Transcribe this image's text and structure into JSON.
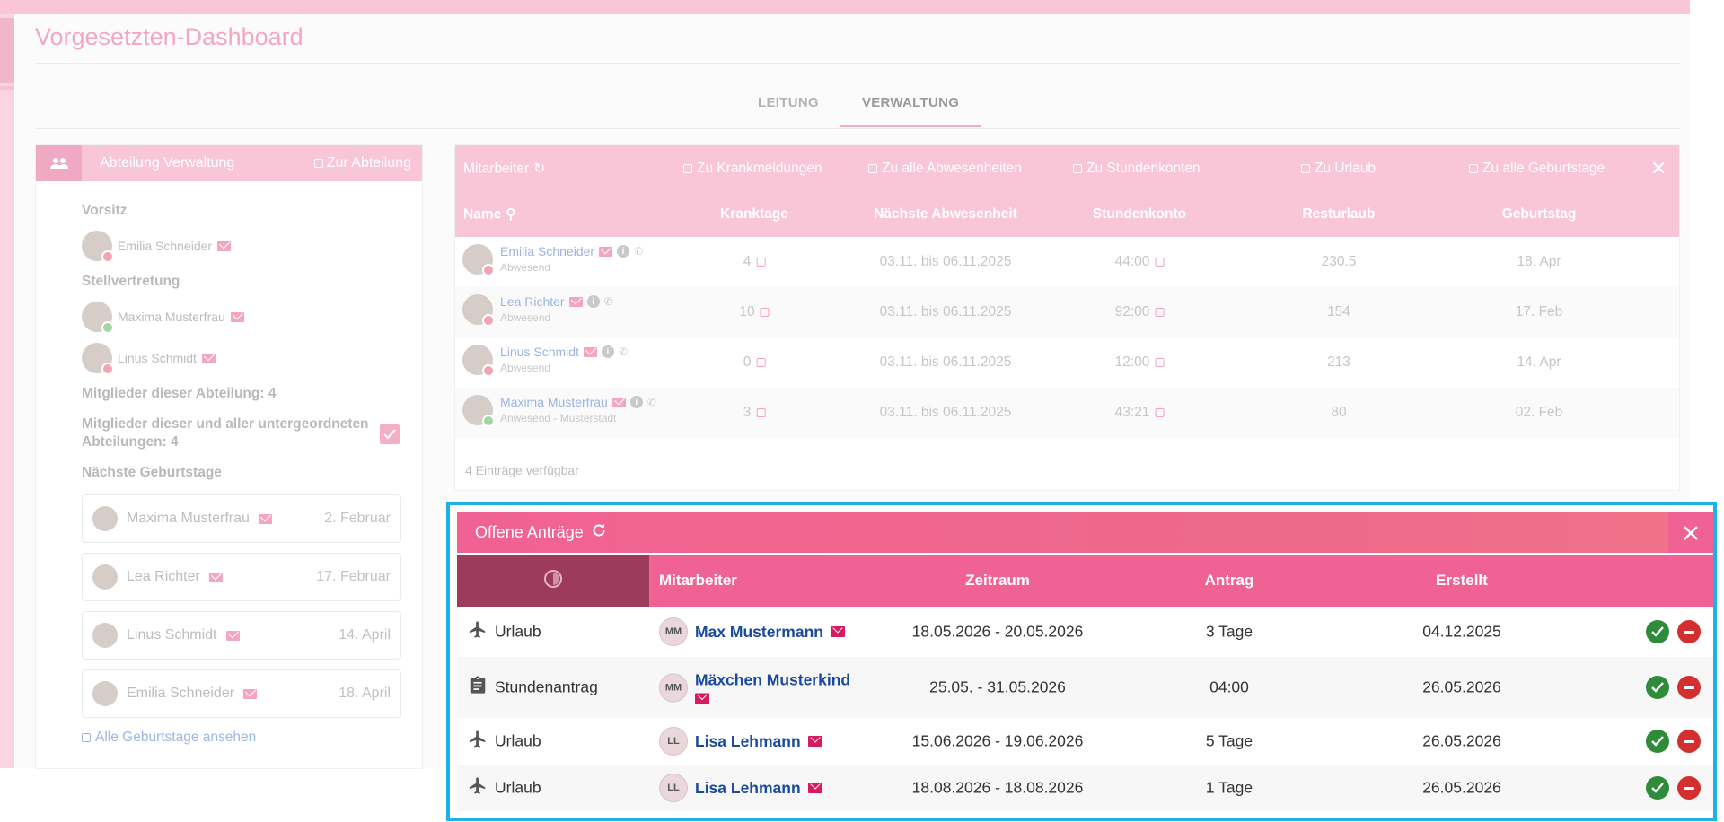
{
  "page": {
    "title": "Vorgesetzten-Dashboard"
  },
  "tabs": [
    {
      "label": "LEITUNG"
    },
    {
      "label": "VERWALTUNG"
    }
  ],
  "department": {
    "title": "Abteilung Verwaltung",
    "link": "Zur Abteilung",
    "chair_label": "Vorsitz",
    "chair": "Emilia Schneider",
    "deputy_label": "Stellvertretung",
    "deputies": [
      "Maxima Musterfrau",
      "Linus Schmidt"
    ],
    "members_count": "Mitglieder dieser Abteilung: 4",
    "members_all_line1": "Mitglieder dieser und aller untergeordneten",
    "members_all_line2": "Abteilungen: 4",
    "birthdays_label": "Nächste Geburtstage",
    "birthdays": [
      {
        "name": "Maxima Musterfrau",
        "date": "2. Februar"
      },
      {
        "name": "Lea Richter",
        "date": "17. Februar"
      },
      {
        "name": "Linus Schmidt",
        "date": "14. April"
      },
      {
        "name": "Emilia Schneider",
        "date": "18. April"
      }
    ],
    "all_birthdays": "Alle Geburtstage ansehen"
  },
  "staff": {
    "links": {
      "employees": "Mitarbeiter",
      "sick": "Zu Krankmeldungen",
      "absences": "Zu alle Abwesenheiten",
      "hours": "Zu Stundenkonten",
      "vacation": "Zu Urlaub",
      "birthdays": "Zu alle Geburtstage"
    },
    "columns": {
      "name": "Name",
      "sick_days": "Kranktage",
      "next_absence": "Nächste Abwesenheit",
      "hours": "Stundenkonto",
      "remaining": "Resturlaub",
      "birthday": "Geburtstag"
    },
    "rows": [
      {
        "name": "Emilia Schneider",
        "status": "Abwesend",
        "sick": "4",
        "absence": "03.11. bis 06.11.2025",
        "hours": "44:00",
        "remaining": "230.5",
        "birthday": "18. Apr"
      },
      {
        "name": "Lea Richter",
        "status": "Abwesend",
        "sick": "10",
        "absence": "03.11. bis 06.11.2025",
        "hours": "92:00",
        "remaining": "154",
        "birthday": "17. Feb"
      },
      {
        "name": "Linus Schmidt",
        "status": "Abwesend",
        "sick": "0",
        "absence": "03.11. bis 06.11.2025",
        "hours": "12:00",
        "remaining": "213",
        "birthday": "14. Apr"
      },
      {
        "name": "Maxima Musterfrau",
        "status": "Anwesend - Musterstadt",
        "sick": "3",
        "absence": "03.11. bis 06.11.2025",
        "hours": "43:21",
        "remaining": "80",
        "birthday": "02. Feb"
      }
    ],
    "footer": "4 Einträge verfügbar"
  },
  "requests": {
    "title": "Offene Anträge",
    "columns": {
      "employee": "Mitarbeiter",
      "period": "Zeitraum",
      "request": "Antrag",
      "created": "Erstellt"
    },
    "rows": [
      {
        "type": "Urlaub",
        "icon": "airplane-icon",
        "initials": "MM",
        "name": "Max Mustermann",
        "period": "18.05.2026 - 20.05.2026",
        "amount": "3 Tage",
        "created": "04.12.2025"
      },
      {
        "type": "Stundenantrag",
        "icon": "clipboard-icon",
        "initials": "MM",
        "name": "Mäxchen Musterkind",
        "period": "25.05. - 31.05.2026",
        "amount": "04:00",
        "created": "26.05.2026"
      },
      {
        "type": "Urlaub",
        "icon": "airplane-icon",
        "initials": "LL",
        "name": "Lisa Lehmann",
        "period": "15.06.2026 - 19.06.2026",
        "amount": "5 Tage",
        "created": "26.05.2026"
      },
      {
        "type": "Urlaub",
        "icon": "airplane-icon",
        "initials": "LL",
        "name": "Lisa Lehmann",
        "period": "18.08.2026 - 18.08.2026",
        "amount": "1 Tage",
        "created": "26.05.2026"
      }
    ]
  },
  "colors": {
    "accent": "#f06293",
    "highlight": "#1fb0e6",
    "approve": "#2e8b3a",
    "reject": "#d32f2f"
  }
}
